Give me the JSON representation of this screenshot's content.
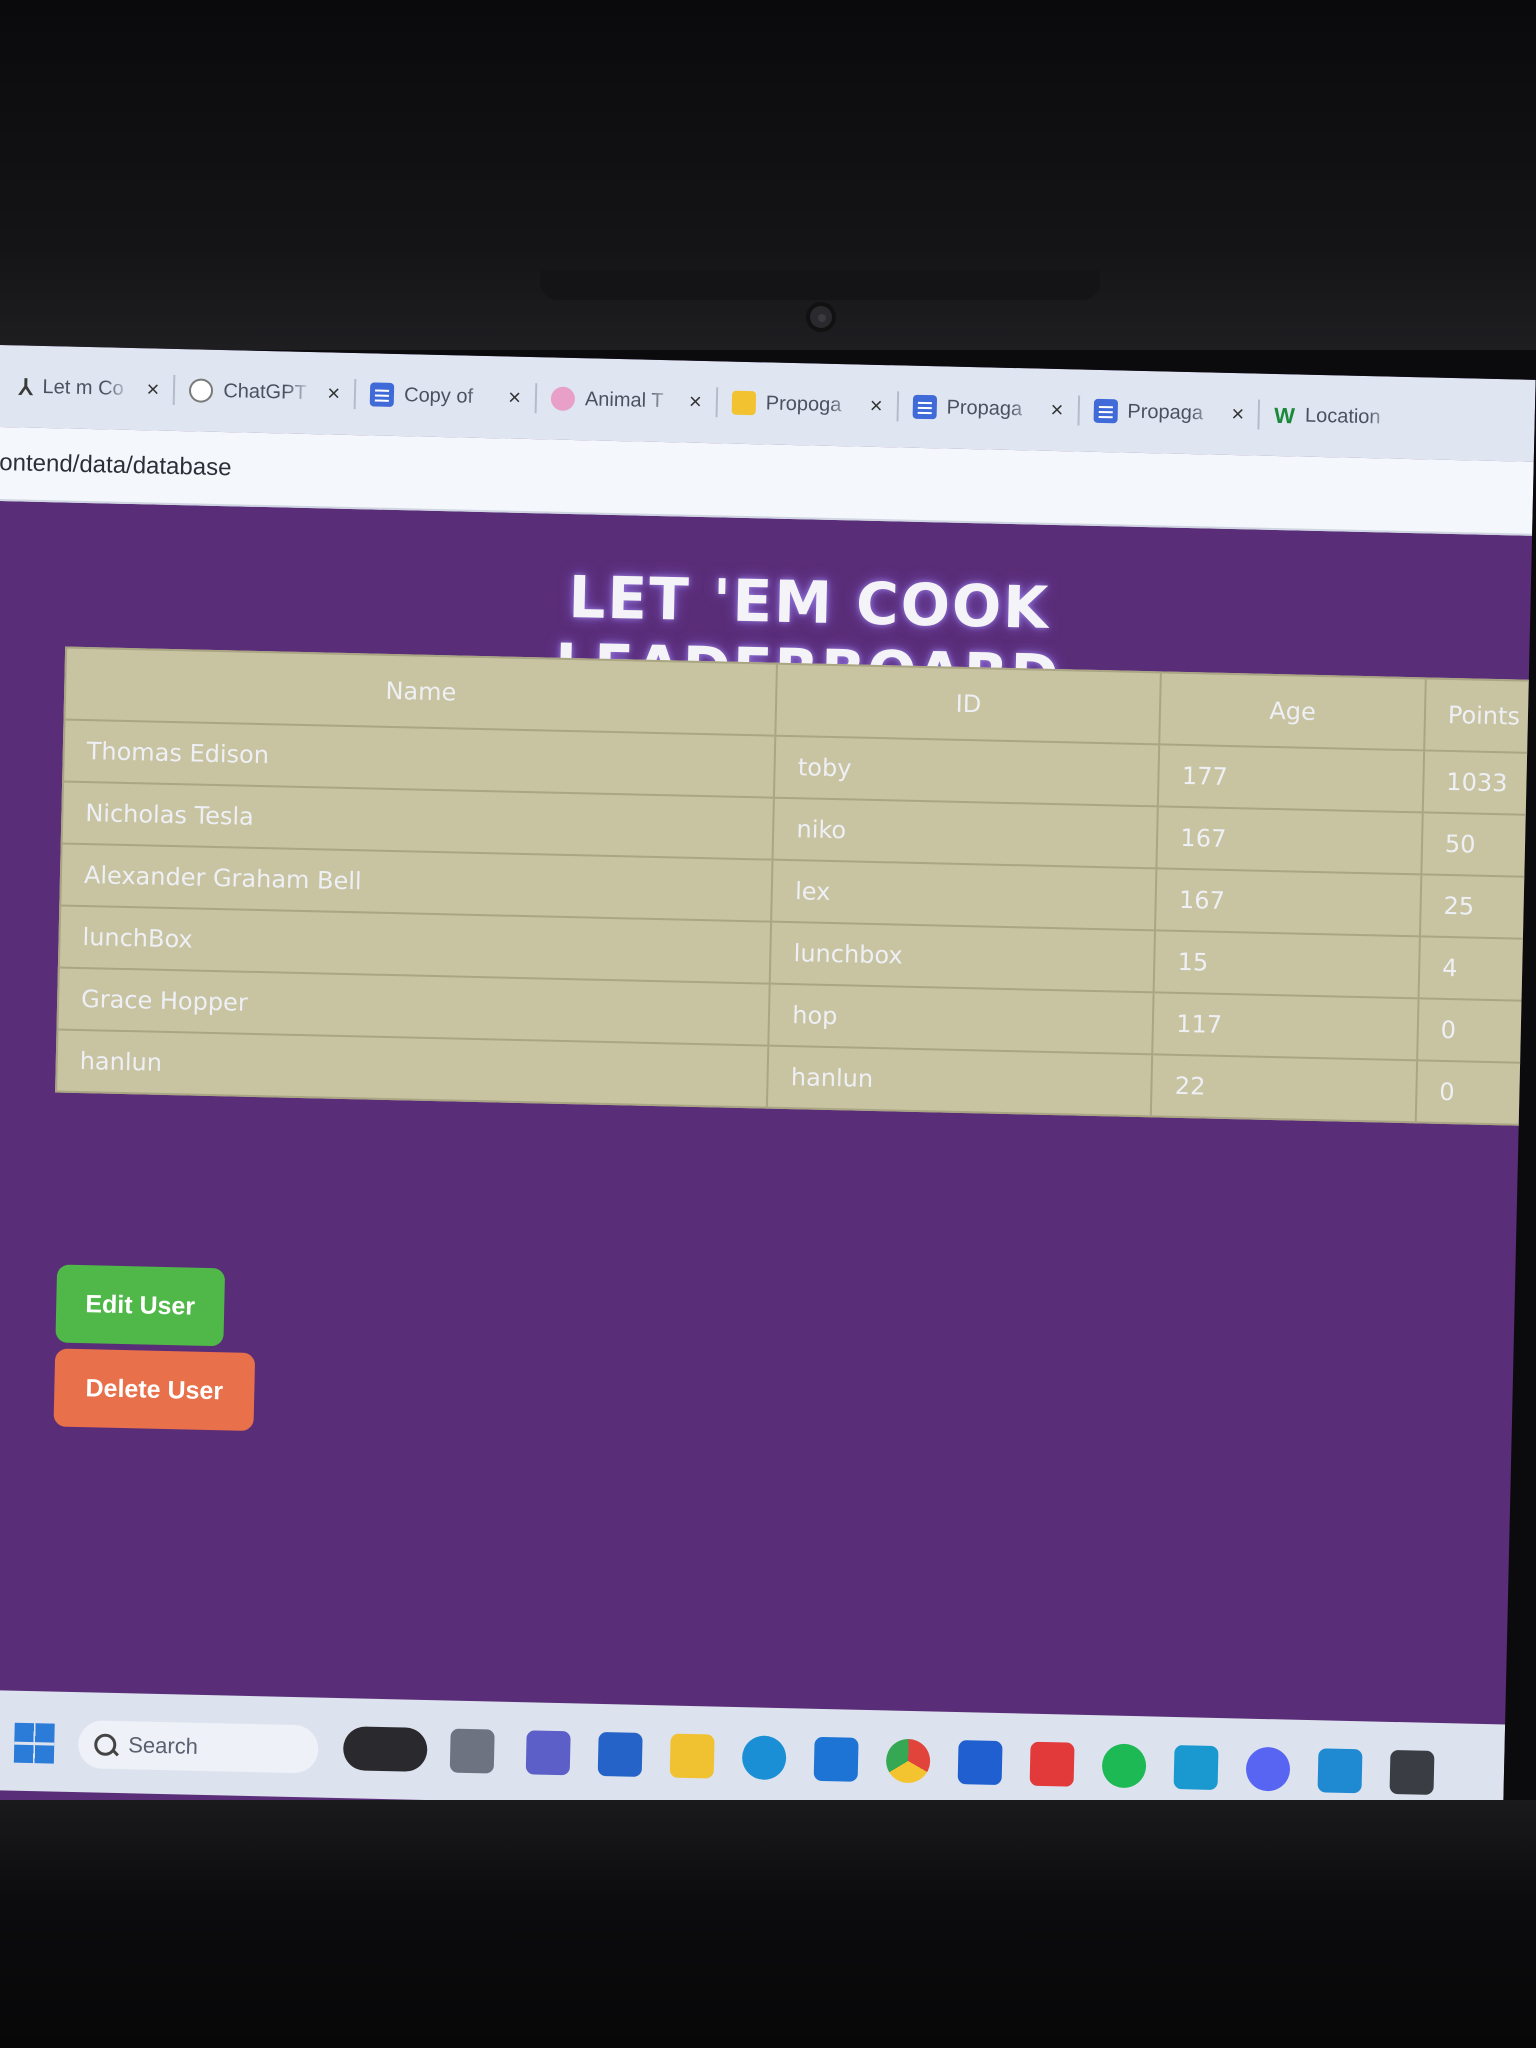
{
  "browser": {
    "tabs": [
      {
        "label": "Let m Co",
        "icon": "lm-icon"
      },
      {
        "label": "ChatGPT",
        "icon": "chatgpt-icon"
      },
      {
        "label": "Copy of",
        "icon": "doc-icon"
      },
      {
        "label": "Animal T",
        "icon": "animal-icon"
      },
      {
        "label": "Propoga",
        "icon": "slides-icon"
      },
      {
        "label": "Propaga",
        "icon": "doc-icon"
      },
      {
        "label": "Propaga",
        "icon": "doc-icon"
      },
      {
        "label": "Location",
        "icon": "wiki-icon"
      }
    ],
    "close_glyph": "×",
    "url": "ontend/data/database"
  },
  "page": {
    "title": "LET 'EM COOK LEADERBOARD",
    "table": {
      "headers": [
        "Name",
        "ID",
        "Age",
        "Points"
      ],
      "rows": [
        [
          "Thomas Edison",
          "toby",
          "177",
          "1033"
        ],
        [
          "Nicholas Tesla",
          "niko",
          "167",
          "50"
        ],
        [
          "Alexander Graham Bell",
          "lex",
          "167",
          "25"
        ],
        [
          "lunchBox",
          "lunchbox",
          "15",
          "4"
        ],
        [
          "Grace Hopper",
          "hop",
          "117",
          "0"
        ],
        [
          "hanlun",
          "hanlun",
          "22",
          "0"
        ]
      ]
    },
    "edit_button": "Edit User",
    "delete_button": "Delete User"
  },
  "taskbar": {
    "search_placeholder": "Search",
    "apps": [
      "windows-start-icon",
      "copilot-icon",
      "task-view-icon",
      "teams-icon",
      "store-icon",
      "file-explorer-icon",
      "edge-icon",
      "app-icon",
      "chrome-icon",
      "lenovo-icon",
      "mcafee-icon",
      "spotify-icon",
      "prime-video-icon",
      "discord-icon",
      "vscode-icon",
      "terminal-icon"
    ]
  },
  "colors": {
    "page_background": "#5a2d78",
    "table_background": "#c8c3a0",
    "edit_button": "#4fb848",
    "delete_button": "#e8704a"
  }
}
